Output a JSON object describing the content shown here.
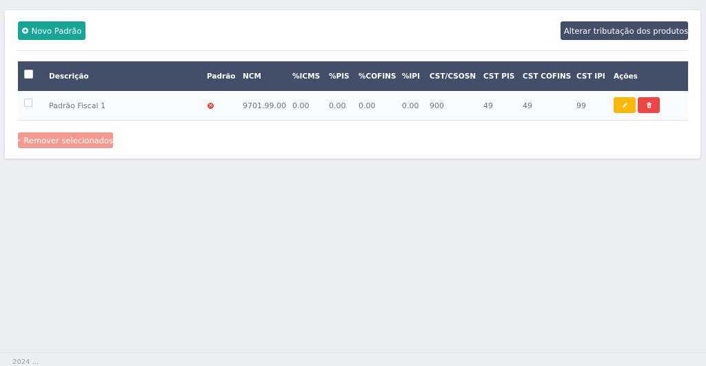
{
  "toolbar": {
    "new_label": "Novo Padrão",
    "alter_label": "Alterar tributação dos produtos",
    "remove_label": "Remover selecionados"
  },
  "table": {
    "columns": [
      "Descrição",
      "Padrão",
      "NCM",
      "%ICMS",
      "%PIS",
      "%COFINS",
      "%IPI",
      "CST/CSOSN",
      "CST PIS",
      "CST COFINS",
      "CST IPI",
      "Ações"
    ],
    "rows": [
      {
        "descricao": "Padrão Fiscal 1",
        "padrao": false,
        "ncm": "9701.99.00",
        "icms": "0.00",
        "pis": "0.00",
        "cofins": "0.00",
        "ipi": "0.00",
        "cst_csosn": "900",
        "cst_pis": "49",
        "cst_cofins": "49",
        "cst_ipi": "99"
      }
    ]
  },
  "footer": {
    "text": "2024 ..."
  },
  "colors": {
    "accent_green": "#17a596",
    "header_dark": "#434e68",
    "edit_yellow": "#fcb90b",
    "delete_red": "#f04545",
    "remove_pink": "#f39a90"
  },
  "icons": {
    "new": "plus-circle-icon",
    "alter": "refresh-icon",
    "remove": "x-circle-icon",
    "padrao_false": "x-circle-icon",
    "edit": "pencil-icon",
    "delete": "trash-icon"
  }
}
